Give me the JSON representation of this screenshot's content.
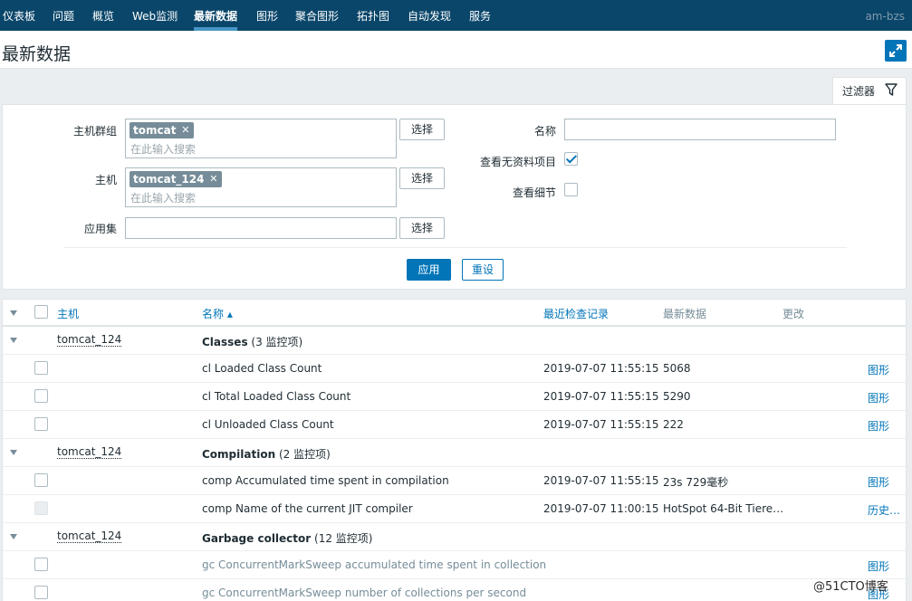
{
  "nav": {
    "items": [
      "仪表板",
      "问题",
      "概览",
      "Web监测",
      "最新数据",
      "图形",
      "聚合图形",
      "拓扑图",
      "自动发现",
      "服务"
    ],
    "active_index": 4,
    "user": "am-bzs"
  },
  "page": {
    "title": "最新数据"
  },
  "filter": {
    "tab_label": "过滤器",
    "host_group_label": "主机群组",
    "host_group_tag": "tomcat",
    "host_label": "主机",
    "host_tag": "tomcat_124",
    "placeholder": "在此输入搜索",
    "app_label": "应用集",
    "select_button": "选择",
    "name_label": "名称",
    "show_without_data_label": "查看无资料项目",
    "show_without_data_checked": true,
    "show_details_label": "查看细节",
    "show_details_checked": false,
    "apply_button": "应用",
    "reset_button": "重设"
  },
  "table": {
    "headers": {
      "host": "主机",
      "name": "名称 ▴",
      "last_check": "最近检查记录",
      "last_value": "最新数据",
      "change": "更改"
    },
    "groups": [
      {
        "host": "tomcat_124",
        "app": "Classes",
        "count": "(3 监控项)",
        "items": [
          {
            "name": "cl Loaded Class Count",
            "time": "2019-07-07 11:55:15",
            "value": "5068",
            "action": "图形"
          },
          {
            "name": "cl Total Loaded Class Count",
            "time": "2019-07-07 11:55:15",
            "value": "5290",
            "action": "图形"
          },
          {
            "name": "cl Unloaded Class Count",
            "time": "2019-07-07 11:55:15",
            "value": "222",
            "action": "图形"
          }
        ]
      },
      {
        "host": "tomcat_124",
        "app": "Compilation",
        "count": "(2 监控项)",
        "items": [
          {
            "name": "comp Accumulated time spent in compilation",
            "time": "2019-07-07 11:55:15",
            "value": "23s 729毫秒",
            "action": "图形"
          },
          {
            "name": "comp Name of the current JIT compiler",
            "time": "2019-07-07 11:00:15",
            "value": "HotSpot 64-Bit Tiere…",
            "action": "历史…"
          }
        ]
      },
      {
        "host": "tomcat_124",
        "app": "Garbage collector",
        "count": "(12 监控项)",
        "items": [
          {
            "name": "gc ConcurrentMarkSweep accumulated time spent in collection",
            "time": "",
            "value": "",
            "action": "图形"
          },
          {
            "name": "gc ConcurrentMarkSweep number of collections per second",
            "time": "",
            "value": "",
            "action": "图形"
          }
        ]
      }
    ]
  },
  "watermark": "@51CTO博客"
}
